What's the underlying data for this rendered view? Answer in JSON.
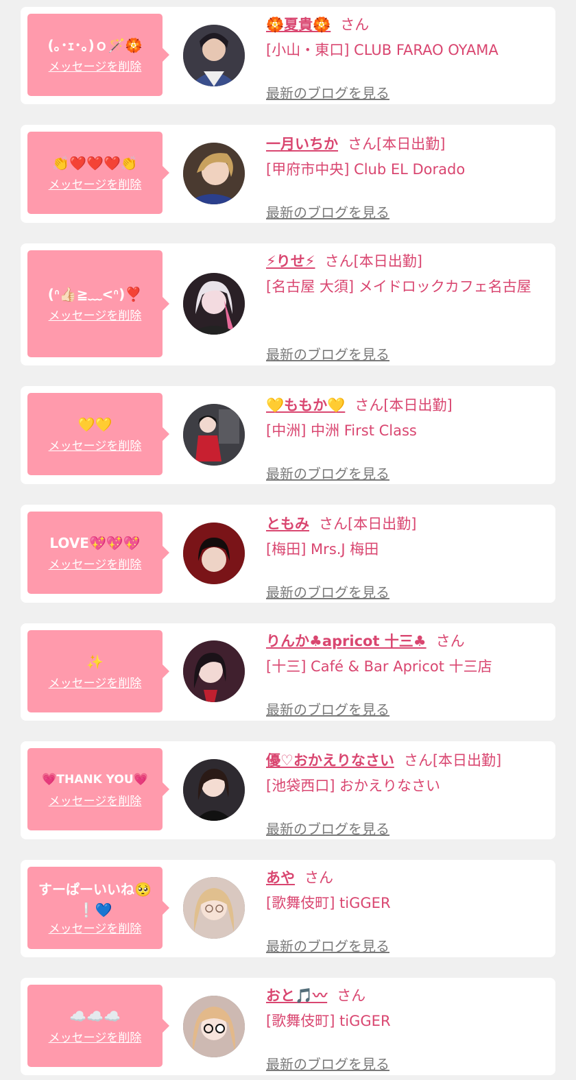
{
  "entries": [
    {
      "message": "(｡･ｪ･｡)ｏ🪄🏵️",
      "delete_label": "メッセージを削除",
      "name": "🏵️夏貴🏵️",
      "san": "さん",
      "shift": "",
      "shop": "[小山・東口] CLUB FARAO OYAMA",
      "blog": "最新のブログを見る"
    },
    {
      "message": "👏❤️❤️❤️👏",
      "delete_label": "メッセージを削除",
      "name": "一月いちか",
      "san": "さん",
      "shift": "[本日出勤]",
      "shop": "[甲府市中央] Club EL Dorado",
      "blog": "最新のブログを見る"
    },
    {
      "message": "(ᐢ👍🏻≧﹏<ᐢ)❣️",
      "delete_label": "メッセージを削除",
      "name": "⚡りせ⚡",
      "san": "さん",
      "shift": "[本日出勤]",
      "shop": "[名古屋 大須] メイドロックカフェ名古屋",
      "blog": "最新のブログを見る"
    },
    {
      "message": "💛💛",
      "delete_label": "メッセージを削除",
      "name": "💛ももか💛",
      "san": "さん",
      "shift": "[本日出勤]",
      "shop": "[中洲] 中洲 First Class",
      "blog": "最新のブログを見る"
    },
    {
      "message": "LOVE💖💖💖",
      "delete_label": "メッセージを削除",
      "name": "ともみ",
      "san": "さん",
      "shift": "[本日出勤]",
      "shop": "[梅田] Mrs.J 梅田",
      "blog": "最新のブログを見る"
    },
    {
      "message": "✨",
      "delete_label": "メッセージを削除",
      "name": "りんか♣apricot 十三♣",
      "san": "さん",
      "shift": "",
      "shop": "[十三] Café & Bar Apricot 十三店",
      "blog": "最新のブログを見る"
    },
    {
      "message": "💗THANK YOU💗",
      "delete_label": "メッセージを削除",
      "name": "優♡おかえりなさい",
      "san": "さん",
      "shift": "[本日出勤]",
      "shop": "[池袋西口] おかえりなさい",
      "blog": "最新のブログを見る"
    },
    {
      "message": "すーぱーいいね🥺❕💙",
      "delete_label": "メッセージを削除",
      "name": "あや",
      "san": "さん",
      "shift": "",
      "shop": "[歌舞伎町] tiGGER",
      "blog": "最新のブログを見る"
    },
    {
      "message": "☁️☁️☁️",
      "delete_label": "メッセージを削除",
      "name": "おと🎵〰",
      "san": "さん",
      "shift": "",
      "shop": "[歌舞伎町] tiGGER",
      "blog": "最新のブログを見る"
    }
  ]
}
